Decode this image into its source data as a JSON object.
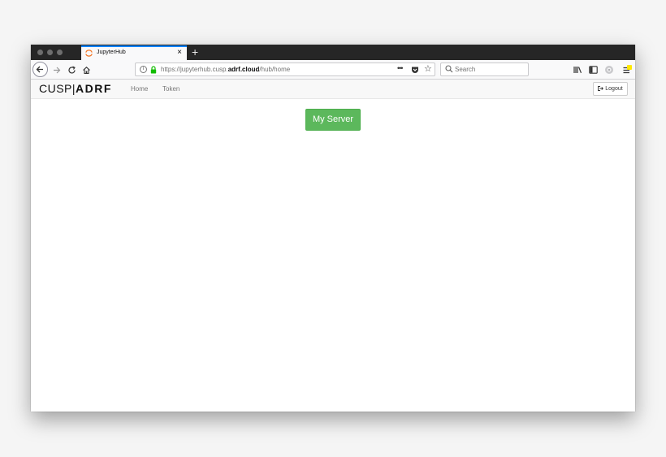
{
  "browser": {
    "tab": {
      "title": "JupyterHub",
      "close": "×"
    },
    "new_tab": "+",
    "url": {
      "prefix": "https://jupyterhub.cusp.",
      "domain": "adrf.cloud",
      "path": "/hub/home"
    },
    "url_actions": "•••",
    "search": {
      "placeholder": "Search"
    }
  },
  "app": {
    "logo": {
      "part1": "CUSP",
      "separator": "|",
      "part2": "ADRF"
    },
    "nav": [
      {
        "label": "Home"
      },
      {
        "label": "Token"
      }
    ],
    "logout": {
      "icon": "logout-icon",
      "label": "Logout"
    },
    "server_button": "My Server"
  },
  "colors": {
    "accent_tab": "#0a84ff",
    "server_button": "#5cb85c",
    "favicon": "#f37524",
    "lock": "#12bc00",
    "menu_badge": "#ffe900"
  }
}
